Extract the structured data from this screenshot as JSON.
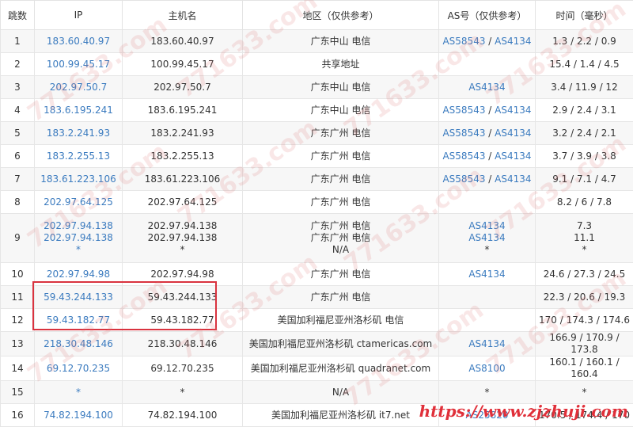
{
  "headers": [
    "跳数",
    "IP",
    "主机名",
    "地区（仅供参考）",
    "AS号（仅供参考）",
    "时间（毫秒）"
  ],
  "rows": [
    {
      "hop": "1",
      "ip": [
        "183.60.40.97"
      ],
      "host": [
        "183.60.40.97"
      ],
      "region": [
        "广东中山 电信"
      ],
      "asn": [
        [
          "AS58543",
          "AS4134"
        ]
      ],
      "time": [
        "1.3 / 2.2 / 0.9"
      ]
    },
    {
      "hop": "2",
      "ip": [
        "100.99.45.17"
      ],
      "host": [
        "100.99.45.17"
      ],
      "region": [
        "共享地址"
      ],
      "asn": [
        []
      ],
      "time": [
        "15.4 / 1.4 / 4.5"
      ]
    },
    {
      "hop": "3",
      "ip": [
        "202.97.50.7"
      ],
      "host": [
        "202.97.50.7"
      ],
      "region": [
        "广东中山 电信"
      ],
      "asn": [
        [
          "AS4134"
        ]
      ],
      "time": [
        "3.4 / 11.9 / 12"
      ]
    },
    {
      "hop": "4",
      "ip": [
        "183.6.195.241"
      ],
      "host": [
        "183.6.195.241"
      ],
      "region": [
        "广东中山 电信"
      ],
      "asn": [
        [
          "AS58543",
          "AS4134"
        ]
      ],
      "time": [
        "2.9 / 2.4 / 3.1"
      ]
    },
    {
      "hop": "5",
      "ip": [
        "183.2.241.93"
      ],
      "host": [
        "183.2.241.93"
      ],
      "region": [
        "广东广州 电信"
      ],
      "asn": [
        [
          "AS58543",
          "AS4134"
        ]
      ],
      "time": [
        "3.2 / 2.4 / 2.1"
      ]
    },
    {
      "hop": "6",
      "ip": [
        "183.2.255.13"
      ],
      "host": [
        "183.2.255.13"
      ],
      "region": [
        "广东广州 电信"
      ],
      "asn": [
        [
          "AS58543",
          "AS4134"
        ]
      ],
      "time": [
        "3.7 / 3.9 / 3.8"
      ]
    },
    {
      "hop": "7",
      "ip": [
        "183.61.223.106"
      ],
      "host": [
        "183.61.223.106"
      ],
      "region": [
        "广东广州 电信"
      ],
      "asn": [
        [
          "AS58543",
          "AS4134"
        ]
      ],
      "time": [
        "9.1 / 7.1 / 4.7"
      ]
    },
    {
      "hop": "8",
      "ip": [
        "202.97.64.125"
      ],
      "host": [
        "202.97.64.125"
      ],
      "region": [
        "广东广州 电信"
      ],
      "asn": [
        []
      ],
      "time": [
        "8.2 / 6 / 7.8"
      ]
    },
    {
      "hop": "9",
      "ip": [
        "202.97.94.138",
        "202.97.94.138",
        "*"
      ],
      "host": [
        "202.97.94.138",
        "202.97.94.138",
        "*"
      ],
      "region": [
        "广东广州 电信",
        "广东广州 电信",
        "N/A"
      ],
      "asn": [
        [
          "AS4134"
        ],
        [
          "AS4134"
        ],
        [
          "*"
        ]
      ],
      "time": [
        "7.3",
        "11.1",
        "*"
      ]
    },
    {
      "hop": "10",
      "ip": [
        "202.97.94.98"
      ],
      "host": [
        "202.97.94.98"
      ],
      "region": [
        "广东广州 电信"
      ],
      "asn": [
        [
          "AS4134"
        ]
      ],
      "time": [
        "24.6 / 27.3 / 24.5"
      ]
    },
    {
      "hop": "11",
      "ip": [
        "59.43.244.133"
      ],
      "host": [
        "59.43.244.133"
      ],
      "region": [
        "广东广州 电信"
      ],
      "asn": [
        []
      ],
      "time": [
        "22.3 / 20.6 / 19.3"
      ]
    },
    {
      "hop": "12",
      "ip": [
        "59.43.182.77"
      ],
      "host": [
        "59.43.182.77"
      ],
      "region": [
        "美国加利福尼亚州洛杉矶 电信"
      ],
      "asn": [
        []
      ],
      "time": [
        "170 / 174.3 / 174.6"
      ]
    },
    {
      "hop": "13",
      "ip": [
        "218.30.48.146"
      ],
      "host": [
        "218.30.48.146"
      ],
      "region": [
        "美国加利福尼亚州洛杉矶 ctamericas.com"
      ],
      "asn": [
        [
          "AS4134"
        ]
      ],
      "time": [
        "166.9 / 170.9 / 173.8"
      ]
    },
    {
      "hop": "14",
      "ip": [
        "69.12.70.235"
      ],
      "host": [
        "69.12.70.235"
      ],
      "region": [
        "美国加利福尼亚州洛杉矶 quadranet.com"
      ],
      "asn": [
        [
          "AS8100"
        ]
      ],
      "time": [
        "160.1 / 160.1 / 160.4"
      ]
    },
    {
      "hop": "15",
      "ip": [
        "*"
      ],
      "host": [
        "*"
      ],
      "region": [
        "N/A"
      ],
      "asn": [
        [
          "*"
        ]
      ],
      "time": [
        "*"
      ]
    },
    {
      "hop": "16",
      "ip": [
        "74.82.194.100"
      ],
      "host": [
        "74.82.194.100"
      ],
      "region": [
        "美国加利福尼亚州洛杉矶 it7.net"
      ],
      "asn": [
        [
          "AS25820"
        ]
      ],
      "time": [
        "170.5 / 174.4 / 170"
      ]
    }
  ],
  "watermark": "771633.com",
  "brand": "https://www.zjzhuji.com",
  "colors": {
    "link": "#3b7bbf",
    "highlight": "#d9333f",
    "stripe": "#f7f7f7"
  }
}
